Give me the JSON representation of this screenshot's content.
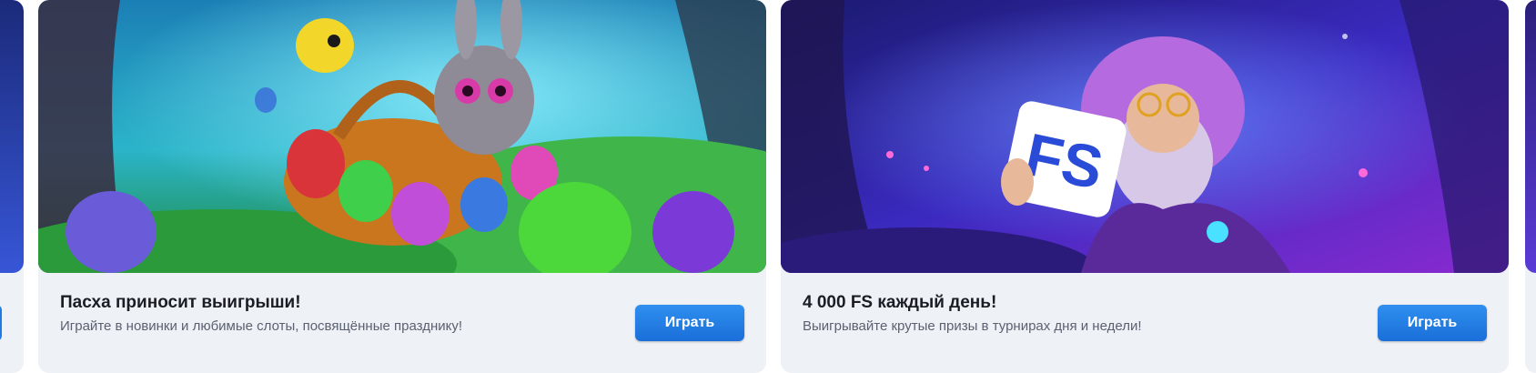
{
  "cards": [
    {
      "title": "Пасха приносит выигрыши!",
      "subtitle": "Играйте в новинки и любимые слоты, посвящённые празднику!",
      "button_label": "Играть",
      "banner_art": "easter-bunny-basket-eggs"
    },
    {
      "title": "4 000 FS каждый день!",
      "subtitle": "Выигрывайте крутые призы в турнирах дня и недели!",
      "button_label": "Играть",
      "banner_art": "wizard-holding-fs-sign",
      "banner_text": "FS"
    }
  ],
  "colors": {
    "card_bg": "#eef1f6",
    "button_bg": "#1f7be3",
    "title": "#1b1d24",
    "subtitle": "#5b6170"
  }
}
